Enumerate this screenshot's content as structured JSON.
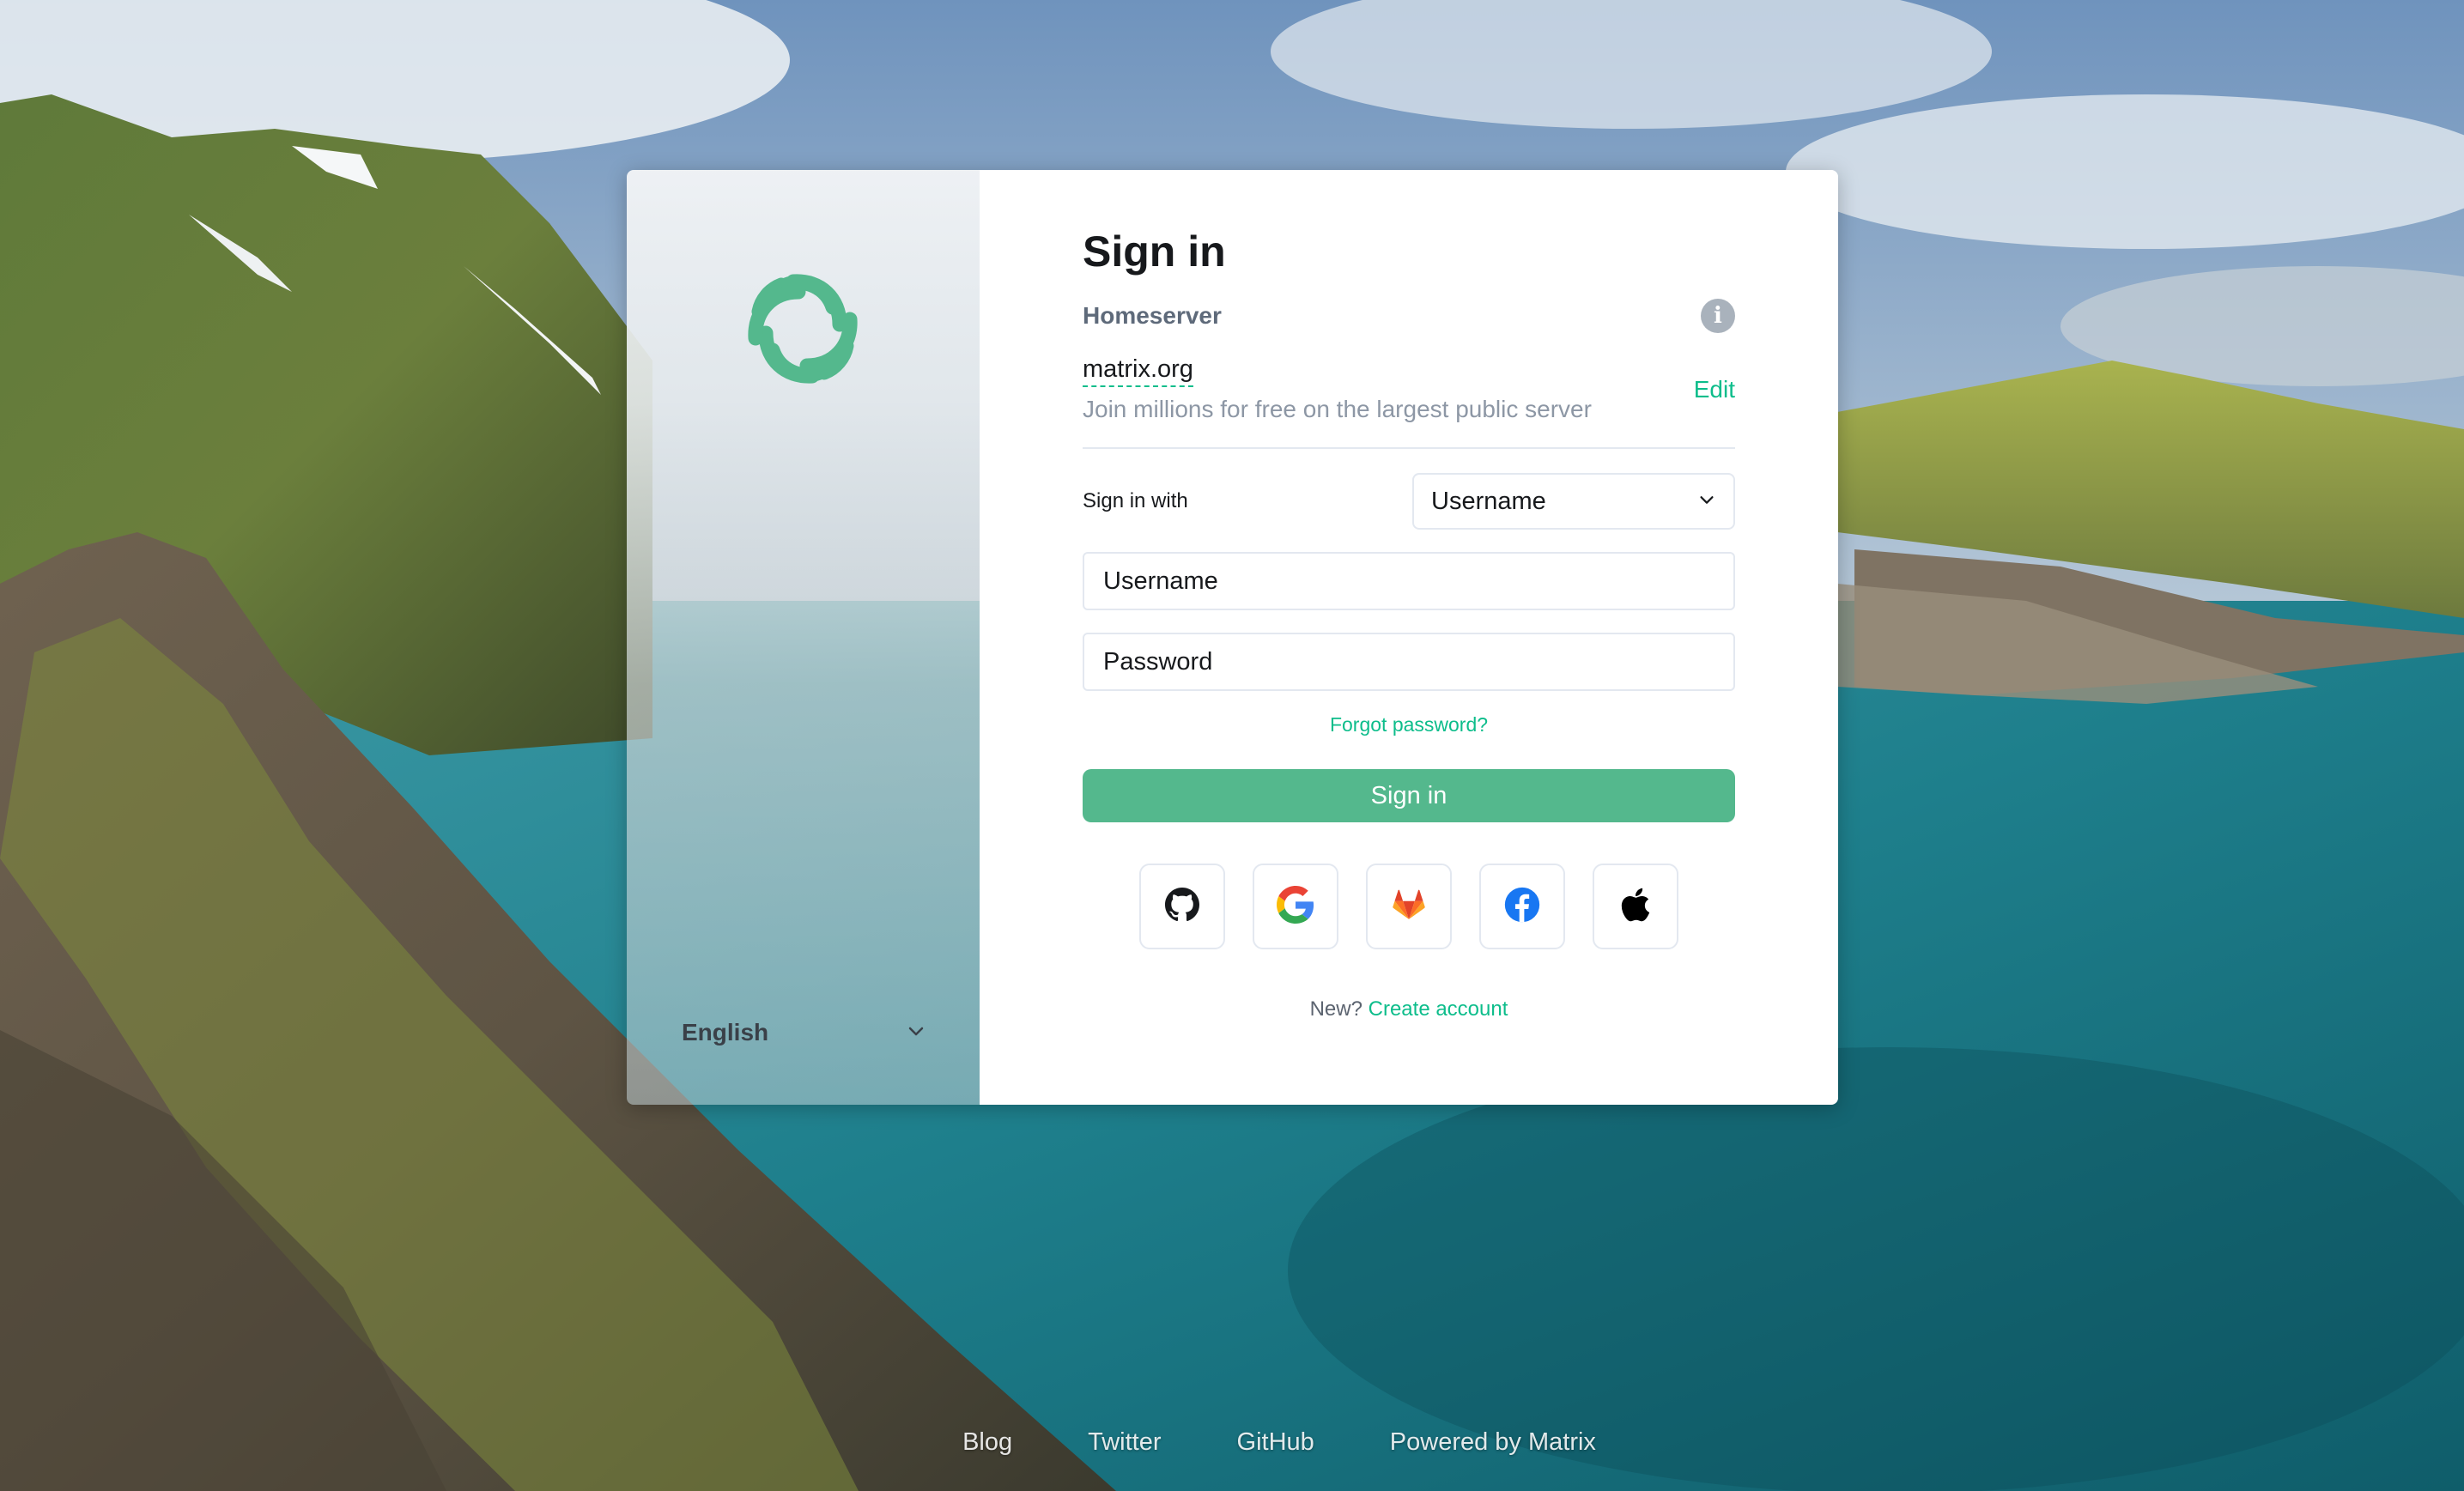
{
  "colors": {
    "accent": "#0dbd8b",
    "button": "#54b88d",
    "logo": "#54b88d"
  },
  "left_panel": {
    "logo_icon": "element-logo-icon",
    "language": "English"
  },
  "auth": {
    "title": "Sign in",
    "homeserver_label": "Homeserver",
    "server_name": "matrix.org",
    "server_description": "Join millions for free on the largest public server",
    "edit_label": "Edit",
    "sign_in_with_label": "Sign in with",
    "sign_in_with_selected": "Username",
    "username_placeholder": "Username",
    "password_placeholder": "Password",
    "forgot_password": "Forgot password?",
    "submit_label": "Sign in",
    "sso_providers": [
      {
        "name": "GitHub",
        "icon": "github-icon"
      },
      {
        "name": "Google",
        "icon": "google-icon"
      },
      {
        "name": "GitLab",
        "icon": "gitlab-icon"
      },
      {
        "name": "Facebook",
        "icon": "facebook-icon"
      },
      {
        "name": "Apple",
        "icon": "apple-icon"
      }
    ],
    "new_prompt": "New?",
    "create_account": "Create account"
  },
  "footer": {
    "links": [
      "Blog",
      "Twitter",
      "GitHub",
      "Powered by Matrix"
    ]
  }
}
